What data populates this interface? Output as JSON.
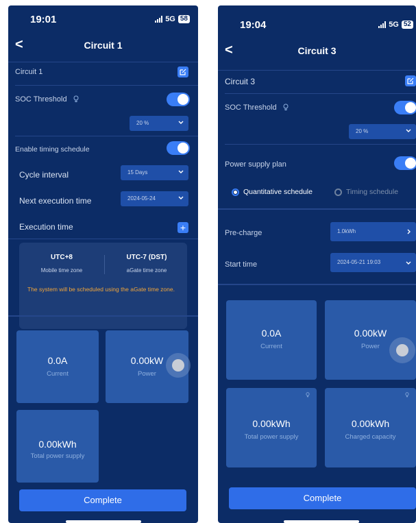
{
  "screenA": {
    "status": {
      "time": "19:01",
      "network": "5G",
      "battery": "58"
    },
    "nav": {
      "back": "<",
      "title": "Circuit 1"
    },
    "name_label": "Circuit 1",
    "soc": {
      "label": "SOC Threshold",
      "value": "20 %"
    },
    "timing": {
      "label": "Enable timing schedule"
    },
    "cycle": {
      "label": "Cycle interval",
      "value": "15 Days"
    },
    "next": {
      "label": "Next execution time",
      "value": "2024-05-24"
    },
    "exec": {
      "label": "Execution time"
    },
    "timezone": {
      "left_tz": "UTC+8",
      "left_caption": "Mobile time zone",
      "right_tz": "UTC-7 (DST)",
      "right_caption": "aGate time zone",
      "note": "The system will be scheduled using the aGate time zone."
    },
    "cards": [
      {
        "value": "0.0A",
        "caption": "Current"
      },
      {
        "value": "0.00kW",
        "caption": "Power"
      },
      {
        "value": "0.00kWh",
        "caption": "Total power supply"
      }
    ],
    "complete": "Complete"
  },
  "screenB": {
    "status": {
      "time": "19:04",
      "network": "5G",
      "battery": "52"
    },
    "nav": {
      "back": "<",
      "title": "Circuit 3"
    },
    "name_label": "Circuit 3",
    "soc": {
      "label": "SOC Threshold",
      "value": "20 %"
    },
    "plan": {
      "label": "Power supply plan"
    },
    "modes": {
      "quantitative": "Quantitative schedule",
      "timing": "Timing schedule"
    },
    "precharge": {
      "label": "Pre-charge",
      "value": "1.0kWh"
    },
    "start": {
      "label": "Start time",
      "value": "2024-05-21 19:03"
    },
    "cards": [
      {
        "value": "0.0A",
        "caption": "Current"
      },
      {
        "value": "0.00kW",
        "caption": "Power"
      },
      {
        "value": "0.00kWh",
        "caption": "Total power supply"
      },
      {
        "value": "0.00kWh",
        "caption": "Charged capacity"
      }
    ],
    "complete": "Complete"
  },
  "colors": {
    "background": "#0c2c66",
    "accent": "#3a7ef6",
    "card": "#2a5aa8",
    "warning": "#f0a53a"
  },
  "icons": [
    "back-icon",
    "edit-icon",
    "bulb-icon",
    "chevron-down-icon",
    "chevron-right-icon",
    "plus-icon",
    "signal-icon",
    "battery-icon"
  ]
}
